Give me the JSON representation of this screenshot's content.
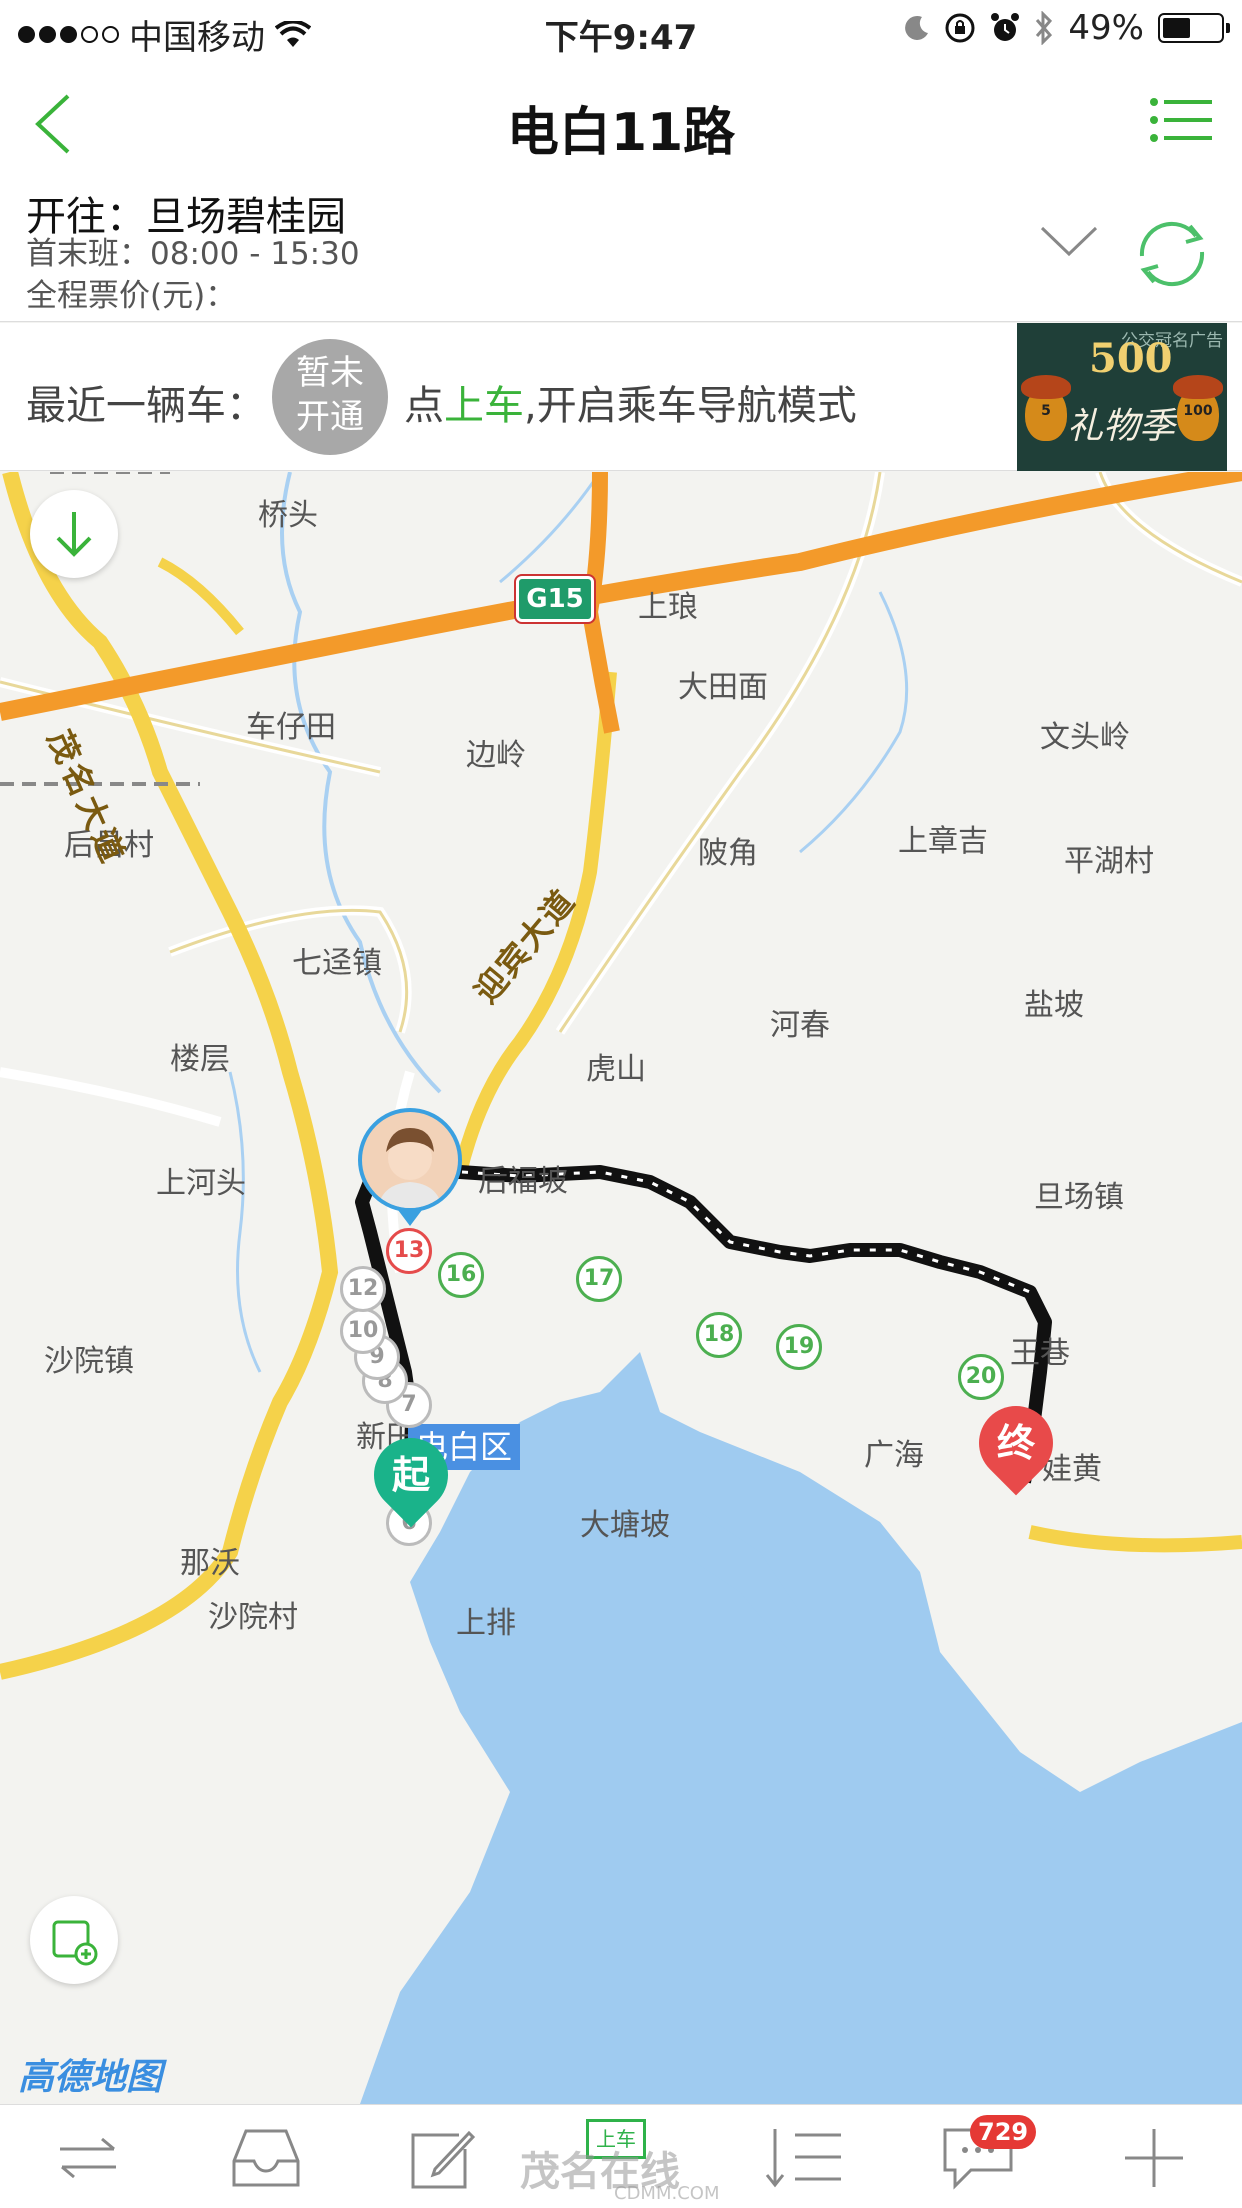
{
  "status_bar": {
    "carrier": "中国移动",
    "time": "下午9:47",
    "battery": "49%",
    "battery_level": 0.49
  },
  "nav": {
    "title": "电白11路"
  },
  "route": {
    "destination": "开往：旦场碧桂园",
    "first_last": "首末班：08:00 - 15:30",
    "fare": "全程票价(元)："
  },
  "nearest": {
    "label": "最近一辆车：",
    "status_line1": "暂未",
    "status_line2": "开通",
    "hint_prefix": "点",
    "hint_action": "上车",
    "hint_suffix": ",开启乘车导航模式"
  },
  "ad": {
    "tag": "公交冠名广告",
    "amount": "500",
    "word": "礼物季",
    "left_coupon": "5",
    "right_coupon": "100"
  },
  "map": {
    "places": [
      {
        "id": "qiaotou",
        "name": "桥头"
      },
      {
        "id": "shanglang",
        "name": "上琅"
      },
      {
        "id": "datianmian",
        "name": "大田面"
      },
      {
        "id": "chezaitian",
        "name": "车仔田"
      },
      {
        "id": "wentouling",
        "name": "文头岭"
      },
      {
        "id": "bianling",
        "name": "边岭"
      },
      {
        "id": "houchangcun",
        "name": "后昌村"
      },
      {
        "id": "shangzhangji",
        "name": "上章吉"
      },
      {
        "id": "pinghucun",
        "name": "平湖村"
      },
      {
        "id": "lingjiao",
        "name": "陂角"
      },
      {
        "id": "qijingzhen",
        "name": "七迳镇"
      },
      {
        "id": "yanpo",
        "name": "盐坡"
      },
      {
        "id": "louceng",
        "name": "楼层"
      },
      {
        "id": "hechun",
        "name": "河春"
      },
      {
        "id": "hushan",
        "name": "虎山"
      },
      {
        "id": "shanghetou",
        "name": "上河头"
      },
      {
        "id": "houfupo",
        "name": "后福坡"
      },
      {
        "id": "danchangzhen",
        "name": "旦场镇"
      },
      {
        "id": "shayuanzhen",
        "name": "沙院镇"
      },
      {
        "id": "wangxiang",
        "name": "王巷"
      },
      {
        "id": "xintian",
        "name": "新田"
      },
      {
        "id": "guanghai",
        "name": "广海"
      },
      {
        "id": "wahuang",
        "name": "娃黄"
      },
      {
        "id": "datangpo",
        "name": "大塘坡"
      },
      {
        "id": "nawo",
        "name": "那沃"
      },
      {
        "id": "shayuancun",
        "name": "沙院村"
      },
      {
        "id": "shangpai",
        "name": "上排"
      }
    ],
    "roads": {
      "maoming": "茂名大道",
      "yingbin": "迎宾大道",
      "expressway": "G15"
    },
    "district": "电白区",
    "brand": "高德地图",
    "stops": [
      "6",
      "7",
      "8",
      "9",
      "10",
      "12",
      "13",
      "16",
      "17",
      "18",
      "19",
      "20"
    ],
    "start_label": "起",
    "end_label": "终"
  },
  "tabbar": {
    "badge": "729",
    "upper_label": "上车",
    "watermark": "茂名在线",
    "watermark_sub": "CDMM.COM"
  },
  "colors": {
    "accent_green": "#3ab33a",
    "expressway": "#f39a2a",
    "main_road": "#f5d24a",
    "water": "#9fcbf0",
    "route_line": "#111111",
    "end_red": "#e84a4a",
    "start_green": "#1ab38a"
  }
}
